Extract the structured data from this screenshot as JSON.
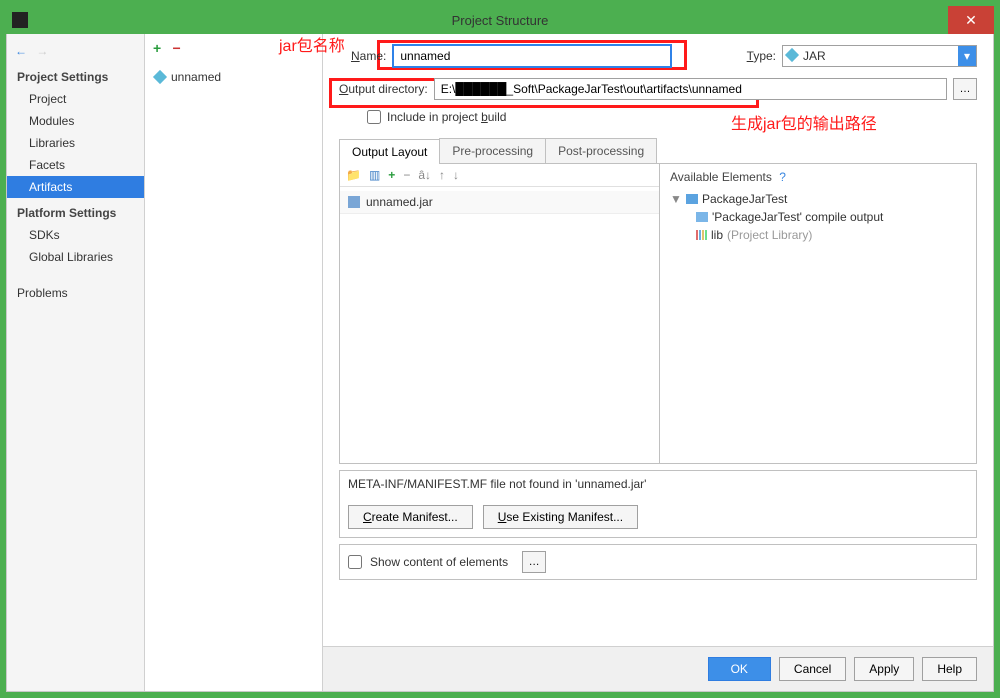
{
  "window": {
    "title": "Project Structure"
  },
  "annotations": {
    "name_label": "jar包名称",
    "output_label": "生成jar包的输出路径"
  },
  "nav": {
    "section1": "Project Settings",
    "items1": [
      "Project",
      "Modules",
      "Libraries",
      "Facets",
      "Artifacts"
    ],
    "section2": "Platform Settings",
    "items2": [
      "SDKs",
      "Global Libraries"
    ],
    "problems": "Problems"
  },
  "artifact_list": {
    "item": "unnamed"
  },
  "form": {
    "name_label": "Name:",
    "name_value": "unnamed",
    "type_label": "Type:",
    "type_value": "JAR",
    "output_label": "Output directory:",
    "output_value": "E:\\██████_Soft\\PackageJarTest\\out\\artifacts\\unnamed",
    "include_label": "Include in project build"
  },
  "tabs": [
    "Output Layout",
    "Pre-processing",
    "Post-processing"
  ],
  "layout": {
    "jar_name": "unnamed.jar",
    "available_header": "Available Elements",
    "tree_root": "PackageJarTest",
    "tree_compile": "'PackageJarTest' compile output",
    "tree_lib": "lib",
    "tree_lib_note": "(Project Library)"
  },
  "manifest": {
    "message": "META-INF/MANIFEST.MF file not found in 'unnamed.jar'",
    "create": "Create Manifest...",
    "use": "Use Existing Manifest..."
  },
  "show_elements": "Show content of elements",
  "footer": {
    "ok": "OK",
    "cancel": "Cancel",
    "apply": "Apply",
    "help": "Help"
  }
}
